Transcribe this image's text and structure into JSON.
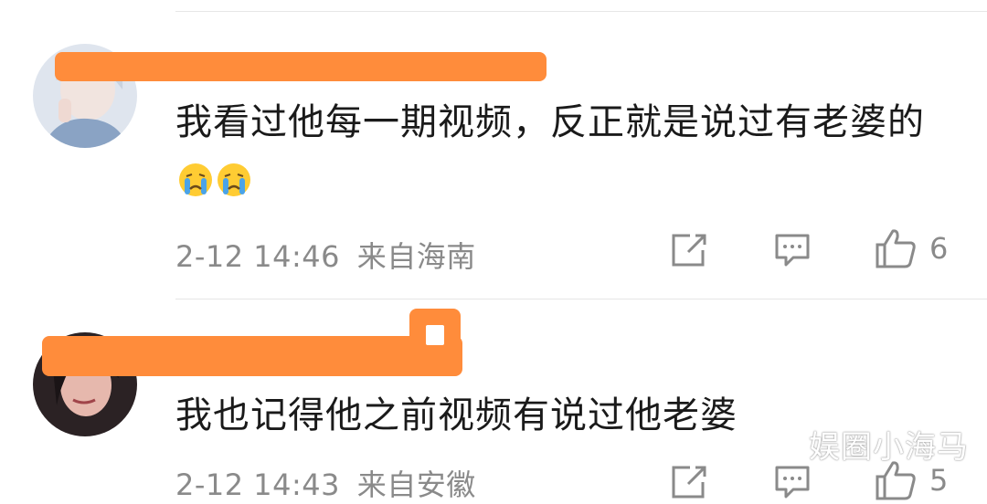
{
  "comments": [
    {
      "text": "我看过他每一期视频，反正就是说过有老婆的",
      "emojis": [
        "crying-face-icon",
        "crying-face-icon"
      ],
      "time": "2-12 14:46",
      "location": "来自海南",
      "likes": "6"
    },
    {
      "text": "我也记得他之前视频有说过他老婆",
      "time": "2-12 14:43",
      "location": "来自安徽",
      "likes": "5"
    }
  ],
  "watermark": "娱圈小海马",
  "colors": {
    "redaction": "#ff8c3b",
    "meta_text": "#8a8a8a",
    "body_text": "#1a1a1a"
  }
}
